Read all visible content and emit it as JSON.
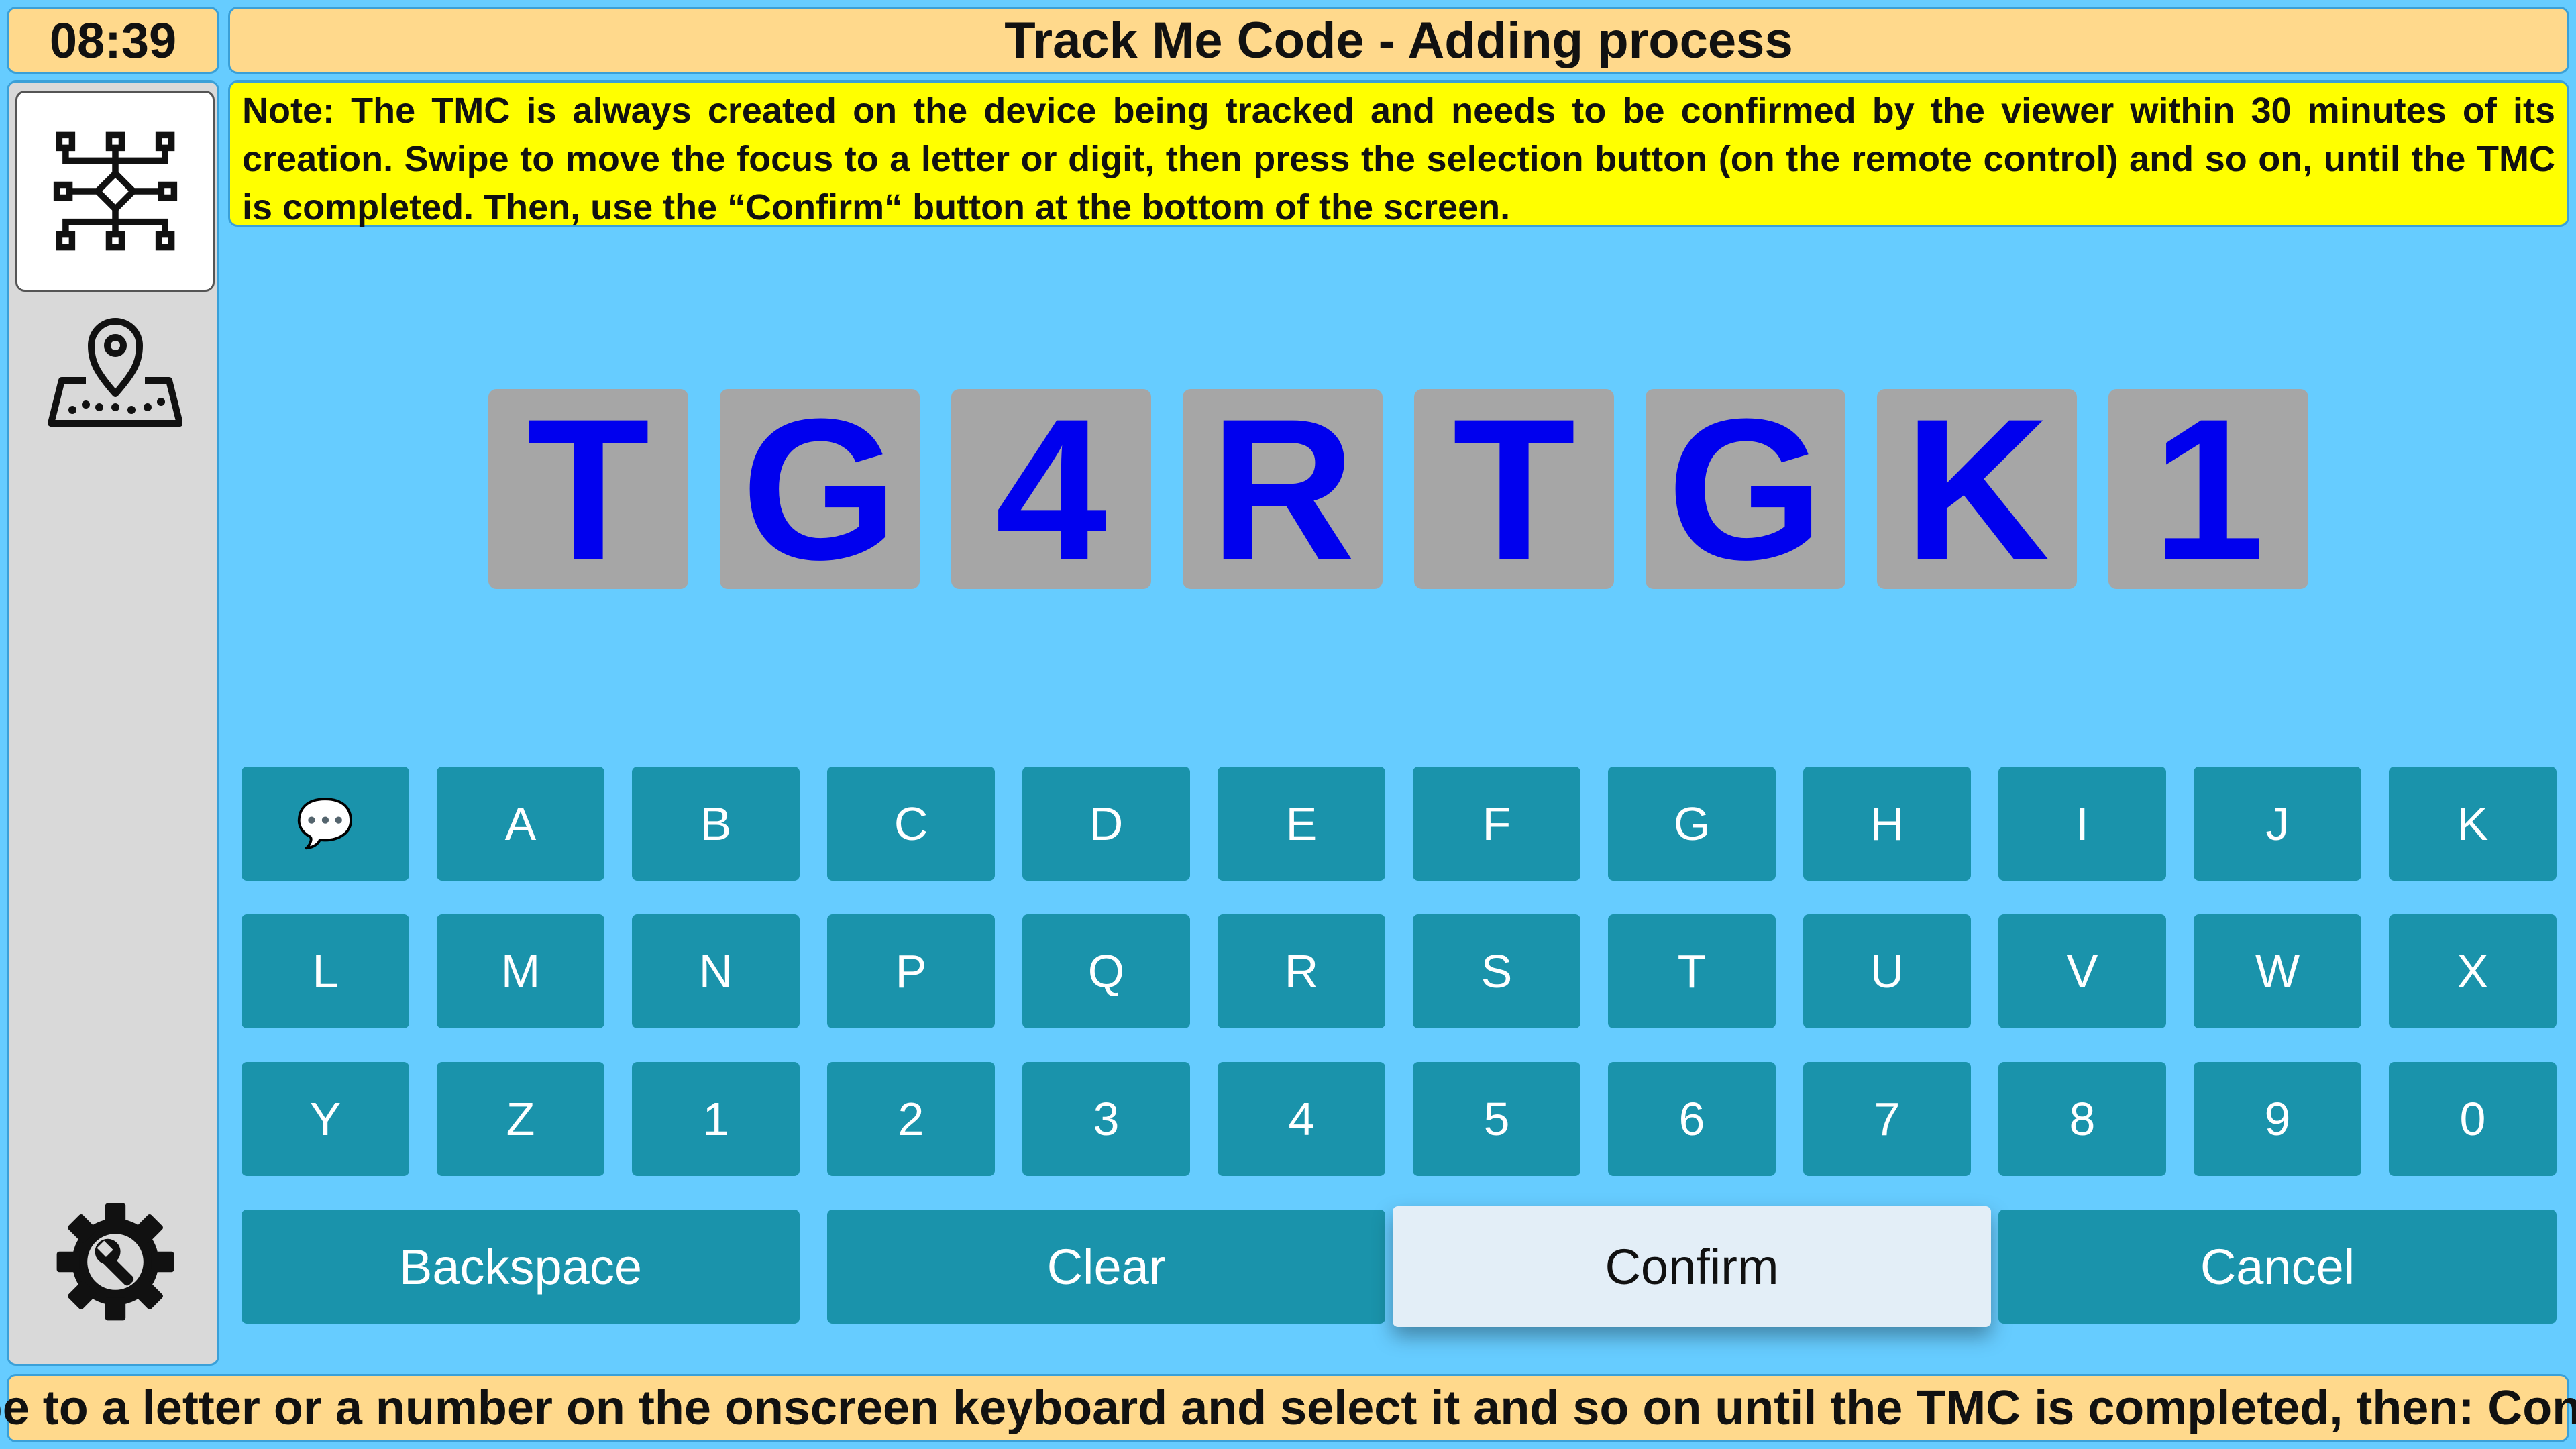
{
  "clock": "08:39",
  "title": "Track Me Code - Adding process",
  "note": "Note: The TMC is always created on the device being tracked and needs to be confirmed by the viewer within 30 minutes of its creation. Swipe to move the focus to a letter or digit, then press the selection button (on the remote control) and so on, until the TMC is completed. Then, use the “Confirm“ button at the bottom of the screen.",
  "sidebar": {
    "items": [
      {
        "icon": "network-diagram-icon",
        "selected": true
      },
      {
        "icon": "map-pin-icon",
        "selected": false
      },
      {
        "icon": "settings-wrench-gear-icon",
        "selected": false
      }
    ]
  },
  "code": [
    "T",
    "G",
    "4",
    "R",
    "T",
    "G",
    "K",
    "1"
  ],
  "code_color": "#0000ee",
  "keyboard": {
    "rows": [
      [
        "💬",
        "A",
        "B",
        "C",
        "D",
        "E",
        "F",
        "G",
        "H",
        "I",
        "J",
        "K"
      ],
      [
        "L",
        "M",
        "N",
        "P",
        "Q",
        "R",
        "S",
        "T",
        "U",
        "V",
        "W",
        "X"
      ],
      [
        "Y",
        "Z",
        "1",
        "2",
        "3",
        "4",
        "5",
        "6",
        "7",
        "8",
        "9",
        "0"
      ]
    ],
    "key_color": "#1a93ab"
  },
  "actions": {
    "backspace": "Backspace",
    "clear": "Clear",
    "confirm": "Confirm",
    "cancel": "Cancel",
    "focused": "confirm"
  },
  "footer": "Swipe to a letter or a number on the onscreen keyboard and select it and so on until the TMC is completed, then: Confirm."
}
